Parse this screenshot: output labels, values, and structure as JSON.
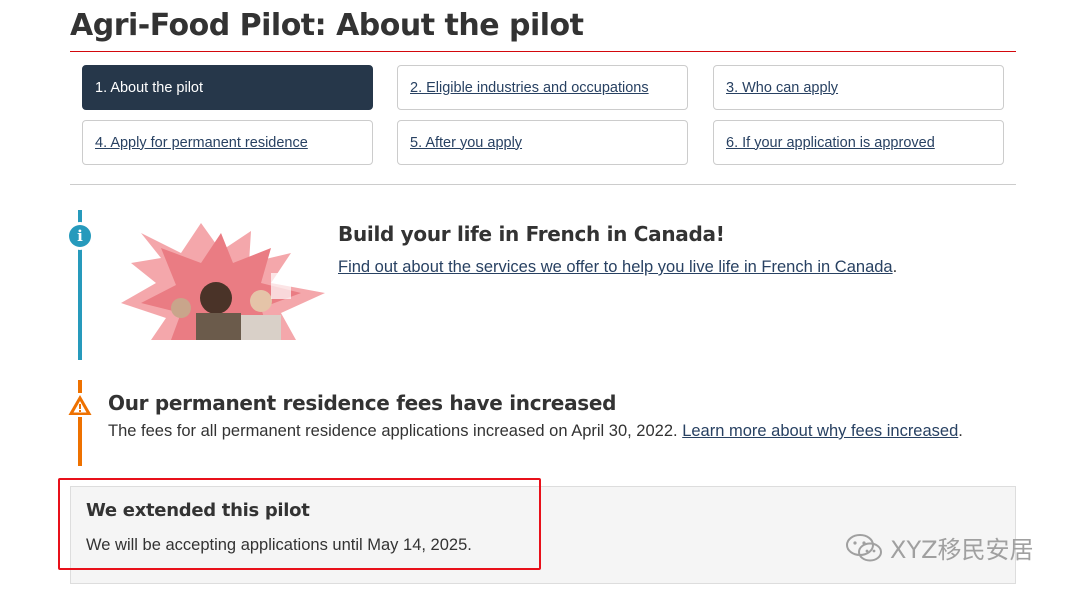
{
  "page": {
    "title": "Agri-Food Pilot: About the pilot"
  },
  "nav": {
    "items": [
      {
        "label": "1. About the pilot",
        "active": true
      },
      {
        "label": "2. Eligible industries and occupations",
        "active": false
      },
      {
        "label": "3. Who can apply",
        "active": false
      },
      {
        "label": "4. Apply for permanent residence",
        "active": false
      },
      {
        "label": "5. After you apply",
        "active": false
      },
      {
        "label": "6. If your application is approved",
        "active": false
      }
    ]
  },
  "info_alert": {
    "icon": "info-icon",
    "heading": "Build your life in French in Canada!",
    "link_text": "Find out about the services we offer to help you live life in French in Canada",
    "after_link": "."
  },
  "warning_alert": {
    "icon": "warning-icon",
    "heading": "Our permanent residence fees have increased",
    "text": "The fees for all permanent residence applications increased on April 30, 2022. ",
    "link_text": "Learn more about why fees increased",
    "after_link": "."
  },
  "extension_panel": {
    "heading": "We extended this pilot",
    "text": "We will be accepting applications until May 14, 2025."
  },
  "watermark": {
    "text": "XYZ移民安居",
    "icon": "wechat-icon"
  },
  "colors": {
    "accent_red": "#d3080c",
    "nav_active": "#26374a",
    "link": "#284162",
    "info": "#269abc",
    "warning": "#ee7100",
    "highlight_box": "#e8101a"
  }
}
